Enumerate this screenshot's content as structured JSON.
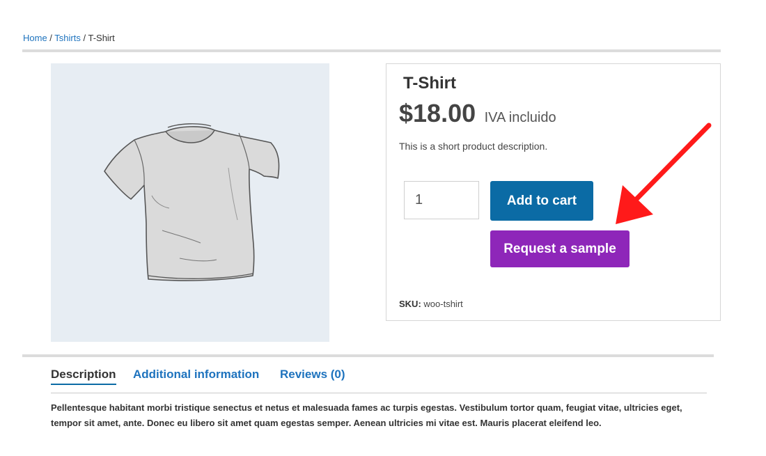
{
  "breadcrumb": {
    "home": "Home",
    "separator1": " / ",
    "category": "Tshirts",
    "separator2": " / ",
    "current": "T-Shirt"
  },
  "product": {
    "title": "T-Shirt",
    "price": "$18.00",
    "tax_note": "IVA incluido",
    "short_description": "This is a short product description.",
    "quantity": "1",
    "add_to_cart_label": "Add to cart",
    "request_sample_label": "Request a sample",
    "sku_label": "SKU:",
    "sku_value": "woo-tshirt",
    "image_icon": "tshirt-illustration"
  },
  "tabs": [
    {
      "label": "Description",
      "active": true
    },
    {
      "label": "Additional information",
      "active": false
    },
    {
      "label": "Reviews (0)",
      "active": false
    }
  ],
  "description": {
    "text": "Pellentesque habitant morbi tristique senectus et netus et malesuada fames ac turpis egestas. Vestibulum tortor quam, feugiat vitae, ultricies eget, tempor sit amet, ante. Donec eu libero sit amet quam egestas semper. Aenean ultricies mi vitae est. Mauris placerat eleifend leo."
  },
  "colors": {
    "link": "#1e73be",
    "add_to_cart_bg": "#0b6ba5",
    "request_sample_bg": "#8e26b9",
    "annotation_arrow": "#ff1a1a"
  }
}
